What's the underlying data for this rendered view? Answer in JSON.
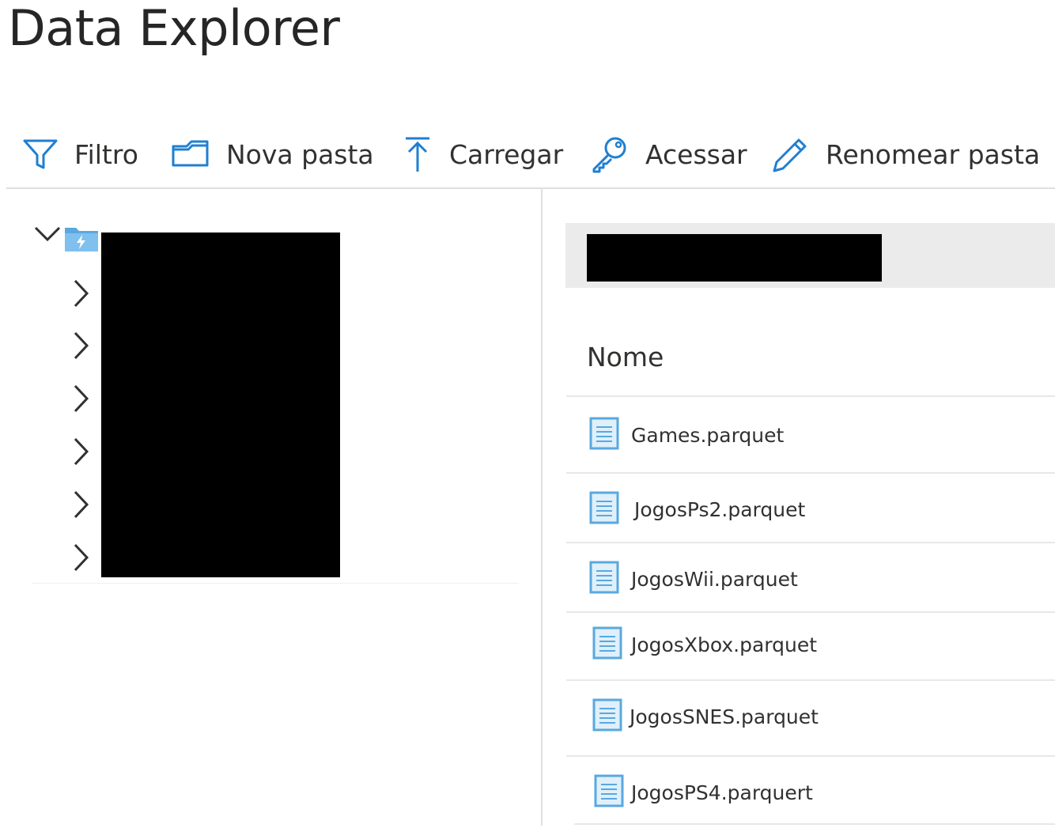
{
  "app": {
    "title": "Data Explorer"
  },
  "toolbar": {
    "buttons": [
      {
        "label": "Filtro",
        "icon": "filter-icon"
      },
      {
        "label": "Nova pasta",
        "icon": "new-folder-icon"
      },
      {
        "label": "Carregar",
        "icon": "upload-icon"
      },
      {
        "label": "Acessar",
        "icon": "key-icon"
      },
      {
        "label": "Renomear pasta",
        "icon": "pencil-icon"
      }
    ]
  },
  "tree": {
    "root": {
      "expanded": true,
      "icon": "storage-folder-icon",
      "label_redacted": true
    },
    "children_count_collapsed": 6
  },
  "list": {
    "column_header": "Nome",
    "files": [
      {
        "name": "Games.parquet",
        "icon": "file-icon"
      },
      {
        "name": "JogosPs2.parquet",
        "icon": "file-icon"
      },
      {
        "name": "JogosWii.parquet",
        "icon": "file-icon"
      },
      {
        "name": "JogosXbox.parquet",
        "icon": "file-icon"
      },
      {
        "name": "JogosSNES.parquet",
        "icon": "file-icon"
      },
      {
        "name": "JogosPS4.parquert",
        "icon": "file-icon"
      }
    ]
  },
  "colors": {
    "accent": "#0078d4",
    "icon_light": "#50a0e0",
    "file_icon_fill": "#dff0fb",
    "text": "#323130",
    "divider": "#e1dfdd",
    "pathbar": "#ebebeb",
    "redaction": "#000000"
  }
}
